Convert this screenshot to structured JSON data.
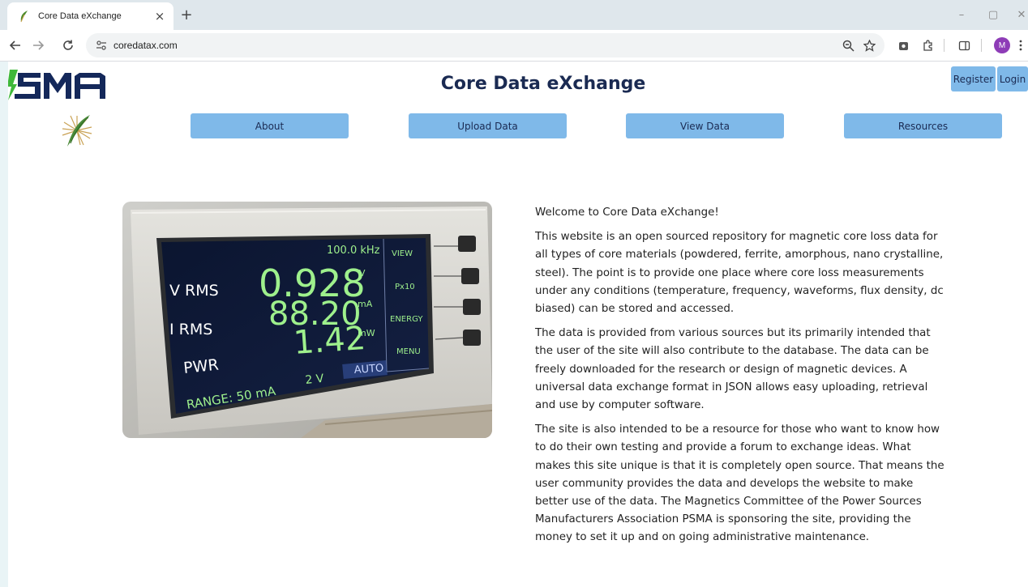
{
  "browser": {
    "tab_title": "Core Data eXchange",
    "tab_close": "×",
    "new_tab": "+",
    "url": "coredatax.com",
    "profile_initial": "M",
    "window_minimize": "–",
    "window_restore": "▢",
    "window_close": "✕"
  },
  "header": {
    "logo_text": "PSMA",
    "title": "Core Data eXchange",
    "register_label": "Register",
    "login_label": "Login"
  },
  "nav": {
    "items": [
      {
        "label": "About"
      },
      {
        "label": "Upload Data"
      },
      {
        "label": "View Data"
      },
      {
        "label": "Resources"
      }
    ]
  },
  "hero": {
    "frequency": "100.0 kHz",
    "vrms_label": "V RMS",
    "irms_label": "I RMS",
    "pwr_label": "PWR",
    "vrms_value": "0.928",
    "vrms_unit": "V",
    "irms_value": "88.20",
    "irms_unit": "mA",
    "pwr_value": "1.42",
    "pwr_unit": "mW",
    "range_label": "RANGE: 50 mA",
    "voltage_range": "2 V",
    "auto_label": "AUTO",
    "side_buttons": [
      "VIEW",
      "Px10",
      "ENERGY",
      "MENU"
    ]
  },
  "main": {
    "welcome": "Welcome to Core Data eXchange!",
    "paragraphs": [
      "This website is an open sourced repository for magnetic core loss data for all types of core materials (powdered, ferrite, amorphous, nano crystalline, steel). The point is to provide one place where core loss measurements under any conditions (temperature, frequency, waveforms, flux density, dc biased) can be stored and accessed.",
      "The data is provided from various sources but its primarily intended that the user of the site will also contribute to the database. The data can be freely downloaded for the research or design of magnetic devices. A universal data exchange format in JSON allows easy uploading, retrieval and use by computer software.",
      "The site is also intended to be a resource for those who want to know how to do their own testing and provide a forum to exchange ideas. What makes this site unique is that it is completely open source. That means the user community provides the data and develops the website to make better use of the data. The Magnetics Committee of the Power Sources Manufacturers Association PSMA is sponsoring the site, providing the money to set it up and on going administrative maintenance."
    ]
  },
  "colors": {
    "nav_button": "#7fb9e9",
    "title": "#1a2a52",
    "logo_navy": "#14285a",
    "logo_green": "#3fb83a",
    "lcd_text": "#9ef08c",
    "lcd_label": "#ffffff"
  }
}
